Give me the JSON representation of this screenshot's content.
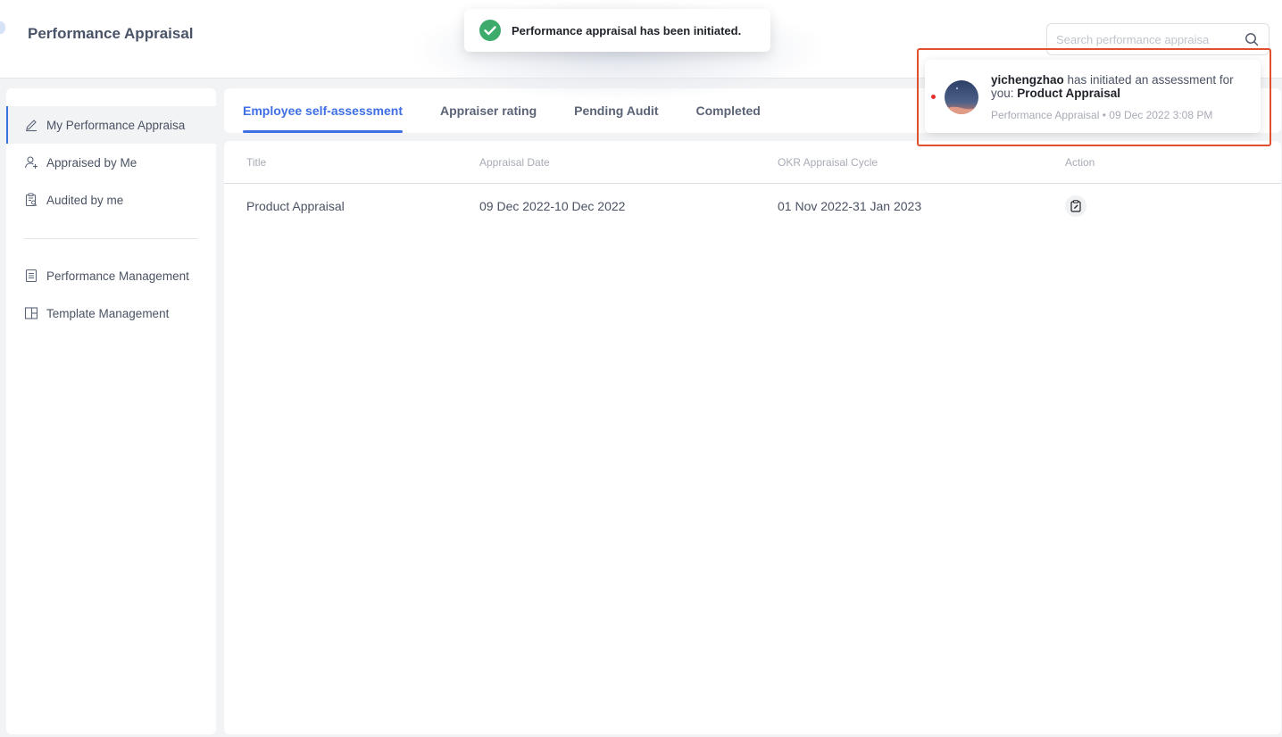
{
  "app": {
    "title": "Performance Appraisal"
  },
  "search": {
    "placeholder": "Search performance appraisa"
  },
  "sidebar": {
    "items": [
      {
        "label": "My Performance Appraisa",
        "icon": "pencil-icon",
        "active": true
      },
      {
        "label": "Appraised by Me",
        "icon": "user-add-icon"
      },
      {
        "label": "Audited by me",
        "icon": "clipboard-search-icon"
      },
      {
        "label": "Performance Management",
        "icon": "document-icon"
      },
      {
        "label": "Template Management",
        "icon": "layout-icon"
      }
    ]
  },
  "tabs": [
    {
      "label": "Employee self-assessment",
      "active": true
    },
    {
      "label": "Appraiser rating"
    },
    {
      "label": "Pending Audit"
    },
    {
      "label": "Completed"
    }
  ],
  "table": {
    "columns": [
      "Title",
      "Appraisal Date",
      "OKR Appraisal Cycle",
      "Action"
    ],
    "rows": [
      {
        "title": "Product Appraisal",
        "date": "09 Dec 2022-10 Dec 2022",
        "cycle": "01 Nov 2022-31 Jan 2023",
        "action_icon": "edit-clipboard-icon"
      }
    ]
  },
  "toast": {
    "message": "Performance appraisal has been initiated.",
    "icon": "check-circle-icon",
    "color": "#3dab6c"
  },
  "notification": {
    "user": "yichengzhao",
    "text_middle": " has initiated an assessment for you: ",
    "target": "Product Appraisal",
    "meta": "Performance Appraisal • 09 Dec 2022 3:08 PM",
    "unread": true,
    "highlight_color": "#e0502f"
  },
  "colors": {
    "accent": "#3f6fe4",
    "background": "#f2f3f5"
  }
}
